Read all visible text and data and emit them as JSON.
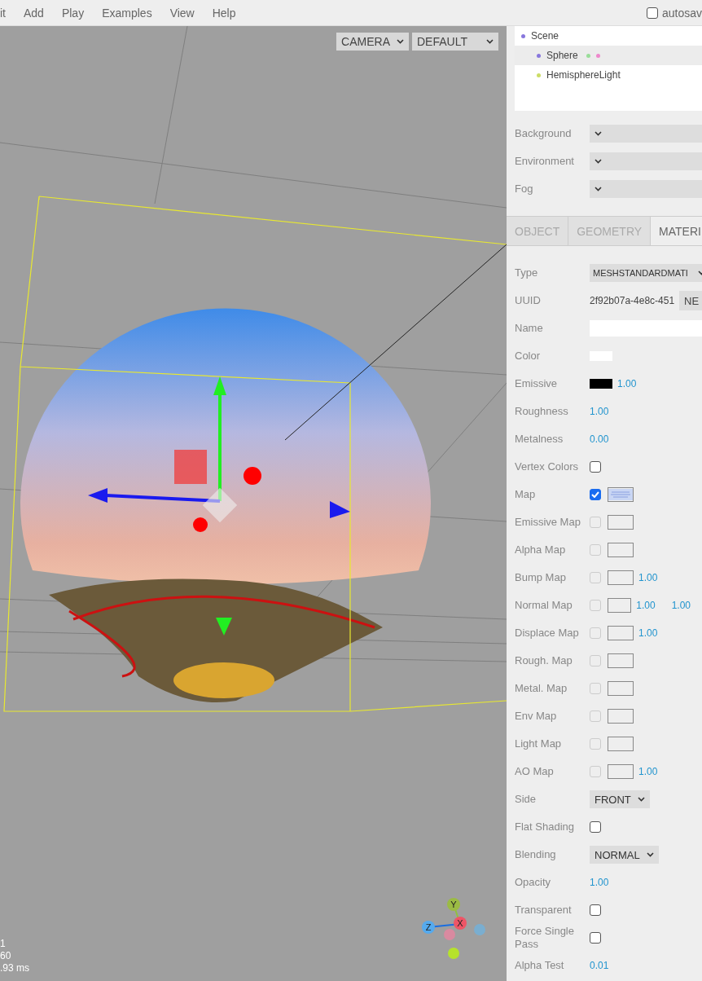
{
  "menubar": {
    "items": [
      "it",
      "Add",
      "Play",
      "Examples",
      "View",
      "Help"
    ],
    "autosave": {
      "label": "autosav",
      "checked": false
    }
  },
  "viewport": {
    "camera_select": "CAMERA",
    "shading_select": "DEFAULT",
    "info": [
      "1",
      "60",
      ".93 ms"
    ],
    "axis_labels": [
      "Y",
      "Z",
      "X"
    ]
  },
  "outliner": {
    "items": [
      {
        "name": "Scene",
        "selected": false,
        "color": "#8877dd",
        "children": [
          {
            "name": "Sphere",
            "selected": true,
            "color": "#8877dd",
            "badges": [
              {
                "color": "#99dd99"
              },
              {
                "color": "#ee88cc"
              }
            ]
          },
          {
            "name": "HemisphereLight",
            "selected": false,
            "color": "#ccdd66"
          }
        ]
      }
    ]
  },
  "scene_settings": [
    {
      "label": "Background"
    },
    {
      "label": "Environment"
    },
    {
      "label": "Fog"
    }
  ],
  "tabs": [
    {
      "label": "OBJECT",
      "selected": false
    },
    {
      "label": "GEOMETRY",
      "selected": false
    },
    {
      "label": "MATERI",
      "selected": true
    }
  ],
  "material_rows": [
    {
      "kind": "wideselect",
      "label": "Type",
      "value": "MESHSTANDARDMATI"
    },
    {
      "kind": "uuid",
      "label": "UUID",
      "value": "2f92b07a-4e8c-451",
      "button": "NE"
    },
    {
      "kind": "text",
      "label": "Name"
    },
    {
      "kind": "color",
      "label": "Color",
      "color": "#ffffff",
      "numbers": []
    },
    {
      "kind": "color",
      "label": "Emissive",
      "color": "#000000",
      "numbers": [
        "1.00"
      ]
    },
    {
      "kind": "number",
      "label": "Roughness",
      "numbers": [
        "1.00"
      ]
    },
    {
      "kind": "number",
      "label": "Metalness",
      "numbers": [
        "0.00"
      ]
    },
    {
      "kind": "checkbox",
      "label": "Vertex Colors",
      "checked": false
    },
    {
      "kind": "map",
      "label": "Map",
      "checked": true,
      "texture": true,
      "numbers": []
    },
    {
      "kind": "map",
      "label": "Emissive Map",
      "checked": false,
      "texture": false,
      "numbers": []
    },
    {
      "kind": "map",
      "label": "Alpha Map",
      "checked": false,
      "texture": false,
      "numbers": []
    },
    {
      "kind": "map",
      "label": "Bump Map",
      "checked": false,
      "texture": false,
      "numbers": [
        "1.00"
      ]
    },
    {
      "kind": "map",
      "label": "Normal Map",
      "checked": false,
      "texture": false,
      "numbers": [
        "1.00",
        "1.00"
      ]
    },
    {
      "kind": "map",
      "label": "Displace Map",
      "checked": false,
      "texture": false,
      "numbers": [
        "1.00"
      ]
    },
    {
      "kind": "map",
      "label": "Rough. Map",
      "checked": false,
      "texture": false,
      "numbers": []
    },
    {
      "kind": "map",
      "label": "Metal. Map",
      "checked": false,
      "texture": false,
      "numbers": []
    },
    {
      "kind": "map",
      "label": "Env Map",
      "checked": false,
      "texture": false,
      "numbers": []
    },
    {
      "kind": "map",
      "label": "Light Map",
      "checked": false,
      "texture": false,
      "numbers": []
    },
    {
      "kind": "map",
      "label": "AO Map",
      "checked": false,
      "texture": false,
      "numbers": [
        "1.00"
      ]
    },
    {
      "kind": "select",
      "label": "Side",
      "value": "FRONT"
    },
    {
      "kind": "checkbox",
      "label": "Flat Shading",
      "checked": false
    },
    {
      "kind": "select",
      "label": "Blending",
      "value": "NORMAL"
    },
    {
      "kind": "number",
      "label": "Opacity",
      "numbers": [
        "1.00"
      ]
    },
    {
      "kind": "checkbox",
      "label": "Transparent",
      "checked": false
    },
    {
      "kind": "checkbox",
      "label": "Force Single Pass",
      "checked": false
    },
    {
      "kind": "number",
      "label": "Alpha Test",
      "numbers": [
        "0.01"
      ]
    }
  ]
}
